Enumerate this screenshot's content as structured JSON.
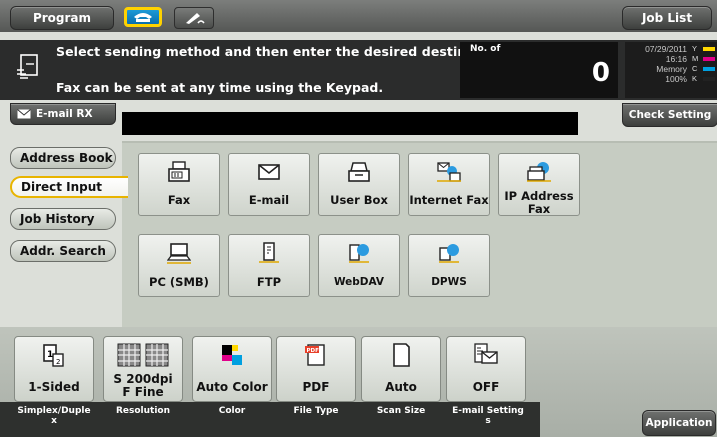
{
  "top": {
    "program": "Program",
    "job_list": "Job List"
  },
  "message": {
    "line1": "Select sending method and then enter the desired destination.",
    "line2": "Fax can be sent at any time using the Keypad."
  },
  "counter": {
    "label": "No. of",
    "value": "0"
  },
  "status": {
    "date": "07/29/2011",
    "time": "16:16",
    "memory_label": "Memory",
    "memory": "100%",
    "toner": [
      "Y",
      "M",
      "C",
      "K"
    ],
    "toner_colors": [
      "#ffd800",
      "#e0008a",
      "#00a0e0",
      "#222222"
    ]
  },
  "dest_row": {
    "email_rx": "E-mail RX",
    "check_setting": "Check Setting"
  },
  "tabs": [
    "Address Book",
    "Direct Input",
    "Job History",
    "Addr. Search"
  ],
  "destinations": [
    {
      "label": "Fax",
      "icon": "fax-icon"
    },
    {
      "label": "E-mail",
      "icon": "envelope-icon"
    },
    {
      "label": "User Box",
      "icon": "user-box-icon"
    },
    {
      "label": "Internet Fax",
      "icon": "internet-fax-icon"
    },
    {
      "label": "IP Address\nFax",
      "icon": "ip-address-fax-icon"
    },
    {
      "label": "PC (SMB)",
      "icon": "pc-icon"
    },
    {
      "label": "FTP",
      "icon": "ftp-icon"
    },
    {
      "label": "WebDAV",
      "icon": "webdav-icon"
    },
    {
      "label": "DPWS",
      "icon": "dpws-icon"
    }
  ],
  "settings": [
    {
      "value": "1-Sided",
      "caption": "Simplex/Duple\nx"
    },
    {
      "value": "S 200dpi\nF Fine",
      "caption": "Resolution"
    },
    {
      "value": "Auto Color",
      "caption": "Color"
    },
    {
      "value": "PDF",
      "caption": "File Type"
    },
    {
      "value": "Auto",
      "caption": "Scan Size"
    },
    {
      "value": "OFF",
      "caption": "E-mail Setting\ns"
    }
  ],
  "application": "Application"
}
